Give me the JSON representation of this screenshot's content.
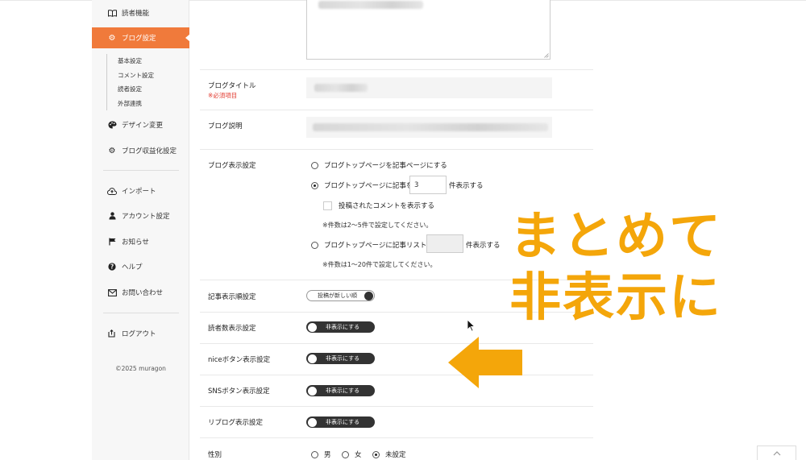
{
  "sidebar": {
    "items_top": [
      {
        "label": "読者機能",
        "icon": "book-icon"
      },
      {
        "label": "ブログ設定",
        "icon": "gear-icon",
        "active": true
      }
    ],
    "subitems": [
      "基本設定",
      "コメント設定",
      "読者設定",
      "外部連携"
    ],
    "items_mid": [
      {
        "label": "デザイン変更",
        "icon": "palette-icon"
      },
      {
        "label": "ブログ収益化設定",
        "icon": "gear-icon"
      }
    ],
    "items_bottom": [
      {
        "label": "インポート",
        "icon": "cloud-upload-icon"
      },
      {
        "label": "アカウント設定",
        "icon": "user-icon"
      },
      {
        "label": "お知らせ",
        "icon": "flag-icon"
      },
      {
        "label": "ヘルプ",
        "icon": "question-icon"
      },
      {
        "label": "お問い合わせ",
        "icon": "mail-icon"
      }
    ],
    "logout": {
      "label": "ログアウト",
      "icon": "logout-icon"
    },
    "copyright": "©2025 muragon",
    "accent_color": "#f07a3b"
  },
  "form": {
    "blog_title": {
      "label": "ブログタイトル",
      "required": "※必須項目"
    },
    "blog_description": {
      "label": "ブログ説明"
    },
    "display": {
      "label": "ブログ表示設定",
      "opt1": "ブログトップページを記事ページにする",
      "opt2_prefix": "ブログトップページに記事を",
      "opt2_value": "3",
      "opt2_suffix": "件表示する",
      "show_comments": "投稿されたコメントを表示する",
      "note1": "※件数は2～5件で設定してください。",
      "opt3_prefix": "ブログトップページに記事リストを",
      "opt3_suffix": "件表示する",
      "note2": "※件数は1～20件で設定してください。"
    },
    "article_order": {
      "label": "記事表示順設定",
      "toggle": "投稿が新しい順"
    },
    "reader_count": {
      "label": "読者数表示設定",
      "toggle": "非表示にする"
    },
    "nice_button": {
      "label": "niceボタン表示設定",
      "toggle": "非表示にする"
    },
    "sns_button": {
      "label": "SNSボタン表示設定",
      "toggle": "非表示にする"
    },
    "reblog": {
      "label": "リブログ表示設定",
      "toggle": "非表示にする"
    },
    "gender": {
      "label": "性別",
      "options": [
        "男",
        "女",
        "未設定"
      ],
      "selected": "未設定"
    }
  },
  "annotation": {
    "line1": "まとめて",
    "line2": "非表示に",
    "color": "#f4a60a"
  },
  "scroll_top_icon": "chevron-up-icon"
}
